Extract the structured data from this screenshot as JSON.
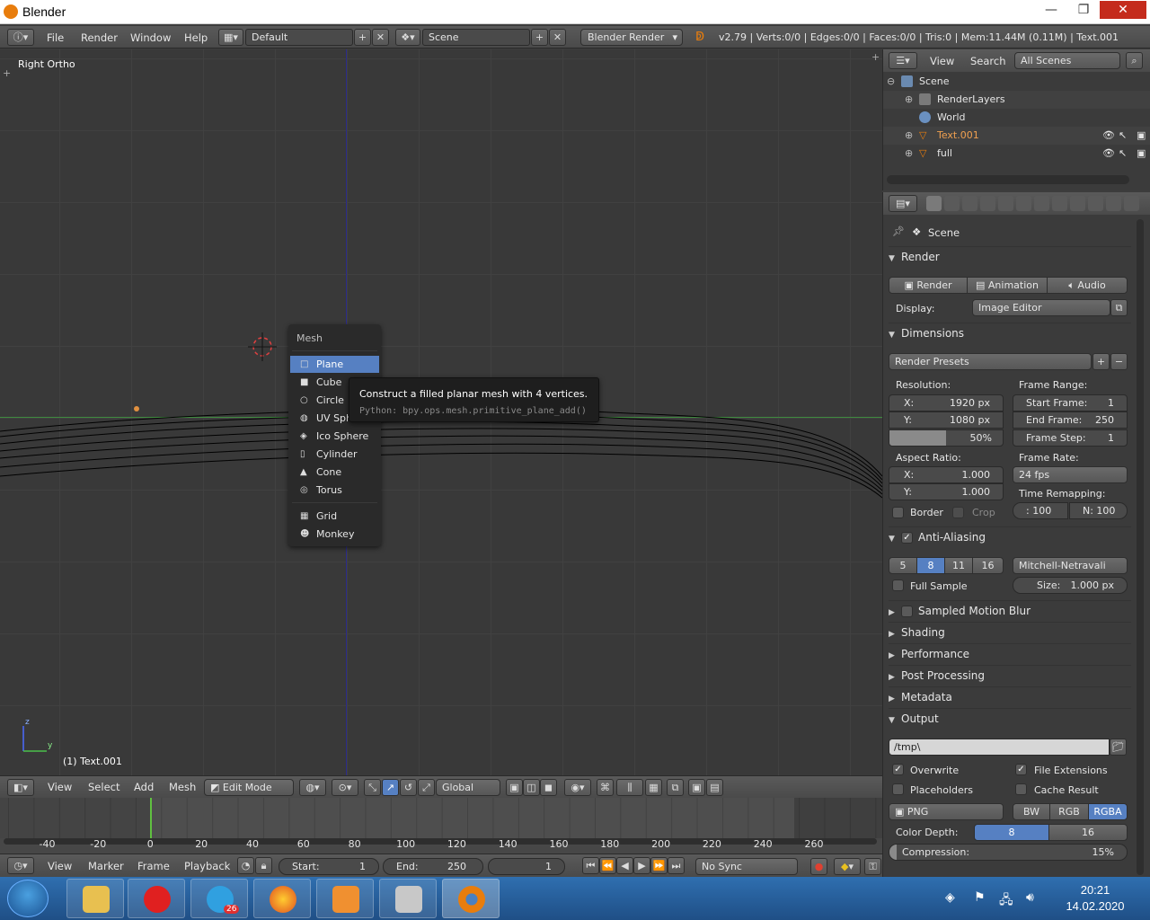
{
  "window": {
    "title": "Blender",
    "min": "—",
    "max": "❐",
    "close": "✕"
  },
  "menubar": {
    "items": [
      "File",
      "Render",
      "Window",
      "Help"
    ],
    "layout": "Default",
    "scene": "Scene",
    "engine": "Blender Render",
    "status": "v2.79 | Verts:0/0 | Edges:0/0 | Faces:0/0 | Tris:0 | Mem:11.44M (0.11M) | Text.001"
  },
  "viewport": {
    "label": "Right Ortho",
    "object_name": "(1) Text.001",
    "axis_z": "z",
    "axis_y": "y"
  },
  "mesh_menu": {
    "title": "Mesh",
    "items": [
      {
        "label": "Plane",
        "icon": "plane-icon",
        "glyph": "□"
      },
      {
        "label": "Cube",
        "icon": "cube-icon",
        "glyph": "■"
      },
      {
        "label": "Circle",
        "icon": "circle-icon",
        "glyph": "○"
      },
      {
        "label": "UV Sphere",
        "icon": "uv-sphere-icon",
        "glyph": "◍"
      },
      {
        "label": "Ico Sphere",
        "icon": "ico-sphere-icon",
        "glyph": "◈"
      },
      {
        "label": "Cylinder",
        "icon": "cylinder-icon",
        "glyph": "▯"
      },
      {
        "label": "Cone",
        "icon": "cone-icon",
        "glyph": "▲"
      },
      {
        "label": "Torus",
        "icon": "torus-icon",
        "glyph": "◎"
      },
      {
        "label": "Grid",
        "icon": "grid-icon",
        "glyph": "▦"
      },
      {
        "label": "Monkey",
        "icon": "monkey-icon",
        "glyph": "☻"
      }
    ],
    "selected": "Plane"
  },
  "tooltip": {
    "description": "Construct a filled planar mesh with 4 vertices.",
    "python": "Python: bpy.ops.mesh.primitive_plane_add()"
  },
  "view3d_header": {
    "menus": [
      "View",
      "Select",
      "Add",
      "Mesh"
    ],
    "mode": "Edit Mode",
    "orientation": "Global"
  },
  "timeline": {
    "ticks": [
      "-40",
      "-20",
      "0",
      "20",
      "40",
      "60",
      "80",
      "100",
      "120",
      "140",
      "160",
      "180",
      "200",
      "220",
      "240",
      "260"
    ],
    "menus": [
      "View",
      "Marker",
      "Frame",
      "Playback"
    ],
    "start_label": "Start:",
    "start_value": "1",
    "end_label": "End:",
    "end_value": "250",
    "current_frame": "1",
    "sync": "No Sync"
  },
  "outliner": {
    "menus": [
      "View",
      "Search"
    ],
    "filter": "All Scenes",
    "rows": [
      {
        "label": "Scene",
        "indent": 0
      },
      {
        "label": "RenderLayers",
        "indent": 1
      },
      {
        "label": "World",
        "indent": 1
      },
      {
        "label": "Text.001",
        "indent": 1
      },
      {
        "label": "full",
        "indent": 1
      }
    ]
  },
  "properties": {
    "context": "Scene",
    "render_panel": "Render",
    "render_btn": "Render",
    "animation_btn": "Animation",
    "audio_btn": "Audio",
    "display_label": "Display:",
    "display_value": "Image Editor",
    "dimensions_panel": "Dimensions",
    "presets": "Render Presets",
    "resolution_label": "Resolution:",
    "res_x_label": "X:",
    "res_x": "1920 px",
    "res_y_label": "Y:",
    "res_y": "1080 px",
    "res_pct": "50%",
    "frame_range_label": "Frame Range:",
    "start_frame_label": "Start Frame:",
    "start_frame": "1",
    "end_frame_label": "End Frame:",
    "end_frame": "250",
    "frame_step_label": "Frame Step:",
    "frame_step": "1",
    "aspect_label": "Aspect Ratio:",
    "asp_x_label": "X:",
    "asp_x": "1.000",
    "asp_y_label": "Y:",
    "asp_y": "1.000",
    "frame_rate_label": "Frame Rate:",
    "frame_rate": "24 fps",
    "time_remap_label": "Time Remapping:",
    "remap_old": ": 100",
    "remap_new": "N: 100",
    "border": "Border",
    "crop": "Crop",
    "aa_panel": "Anti-Aliasing",
    "aa_samples": [
      "5",
      "8",
      "11",
      "16"
    ],
    "aa_selected": "8",
    "aa_filter": "Mitchell-Netravali",
    "full_sample": "Full Sample",
    "size_label": "Size:",
    "size_value": "1.000 px",
    "collapsed_panels": [
      "Sampled Motion Blur",
      "Shading",
      "Performance",
      "Post Processing",
      "Metadata"
    ],
    "output_panel": "Output",
    "output_path": "/tmp\\",
    "overwrite": "Overwrite",
    "file_ext": "File Extensions",
    "placeholders": "Placeholders",
    "cache_result": "Cache Result",
    "format": "PNG",
    "color_modes": [
      "BW",
      "RGB",
      "RGBA"
    ],
    "color_mode_selected": "RGBA",
    "color_depth_label": "Color Depth:",
    "depth_options": [
      "8",
      "16"
    ],
    "depth_selected": "8",
    "compression_label": "Compression:",
    "compression_value": "15%"
  },
  "taskbar": {
    "apps": [
      "file-explorer",
      "opera",
      "telegram",
      "firefox",
      "sublime-text",
      "control-panel",
      "blender"
    ],
    "telegram_badge": "26",
    "time": "20:21",
    "date": "14.02.2020"
  },
  "colors": {
    "accent": "#5680c2",
    "selected_text": "#e87d0d"
  }
}
